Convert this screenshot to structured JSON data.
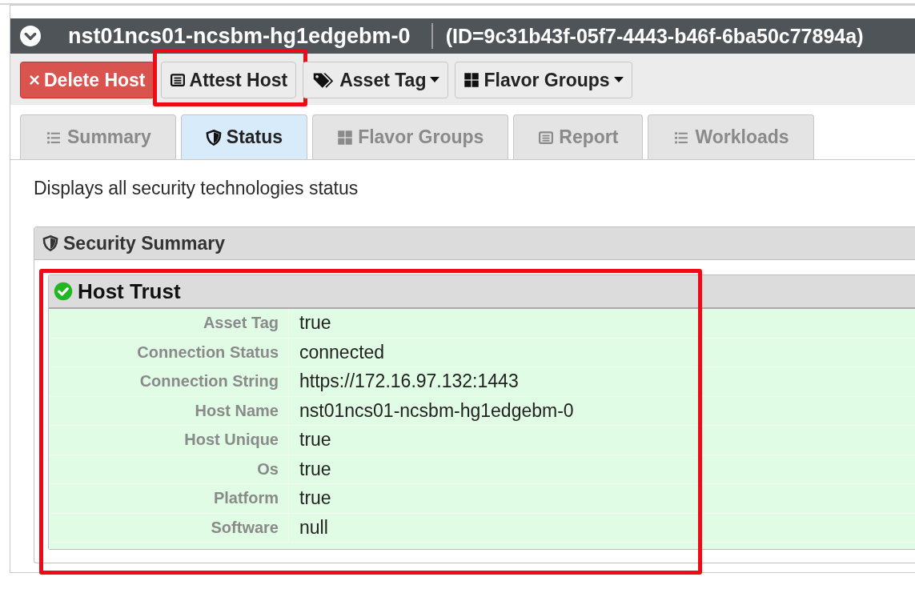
{
  "header": {
    "title": "nst01ncs01-ncsbm-hg1edgebm-0",
    "id_text": "(ID=9c31b43f-05f7-4443-b46f-6ba50c77894a)"
  },
  "toolbar": [
    {
      "label": "Delete Host",
      "kind": "danger",
      "dropdown": false,
      "highlighted": false
    },
    {
      "label": "Attest Host",
      "kind": "default",
      "dropdown": false,
      "highlighted": true
    },
    {
      "label": "Asset Tag",
      "kind": "default",
      "dropdown": true,
      "highlighted": false
    },
    {
      "label": "Flavor Groups",
      "kind": "default",
      "dropdown": true,
      "highlighted": false
    }
  ],
  "tabs": [
    {
      "label": "Summary",
      "selected": false
    },
    {
      "label": "Status",
      "selected": true
    },
    {
      "label": "Flavor Groups",
      "selected": false
    },
    {
      "label": "Report",
      "selected": false
    },
    {
      "label": "Workloads",
      "selected": false
    }
  ],
  "description": "Displays all security technologies status",
  "security_summary": {
    "title": "Security Summary",
    "panels": [
      {
        "title": "Host Trust",
        "trusted": true,
        "highlighted": true,
        "rows": [
          {
            "label": "Asset Tag",
            "value": "true"
          },
          {
            "label": "Connection Status",
            "value": "connected"
          },
          {
            "label": "Connection String",
            "value": "https://172.16.97.132:1443"
          },
          {
            "label": "Host Name",
            "value": "nst01ncs01-ncsbm-hg1edgebm-0"
          },
          {
            "label": "Host Unique",
            "value": "true"
          },
          {
            "label": "Os",
            "value": "true"
          },
          {
            "label": "Platform",
            "value": "true"
          },
          {
            "label": "Software",
            "value": "null"
          }
        ]
      }
    ]
  }
}
